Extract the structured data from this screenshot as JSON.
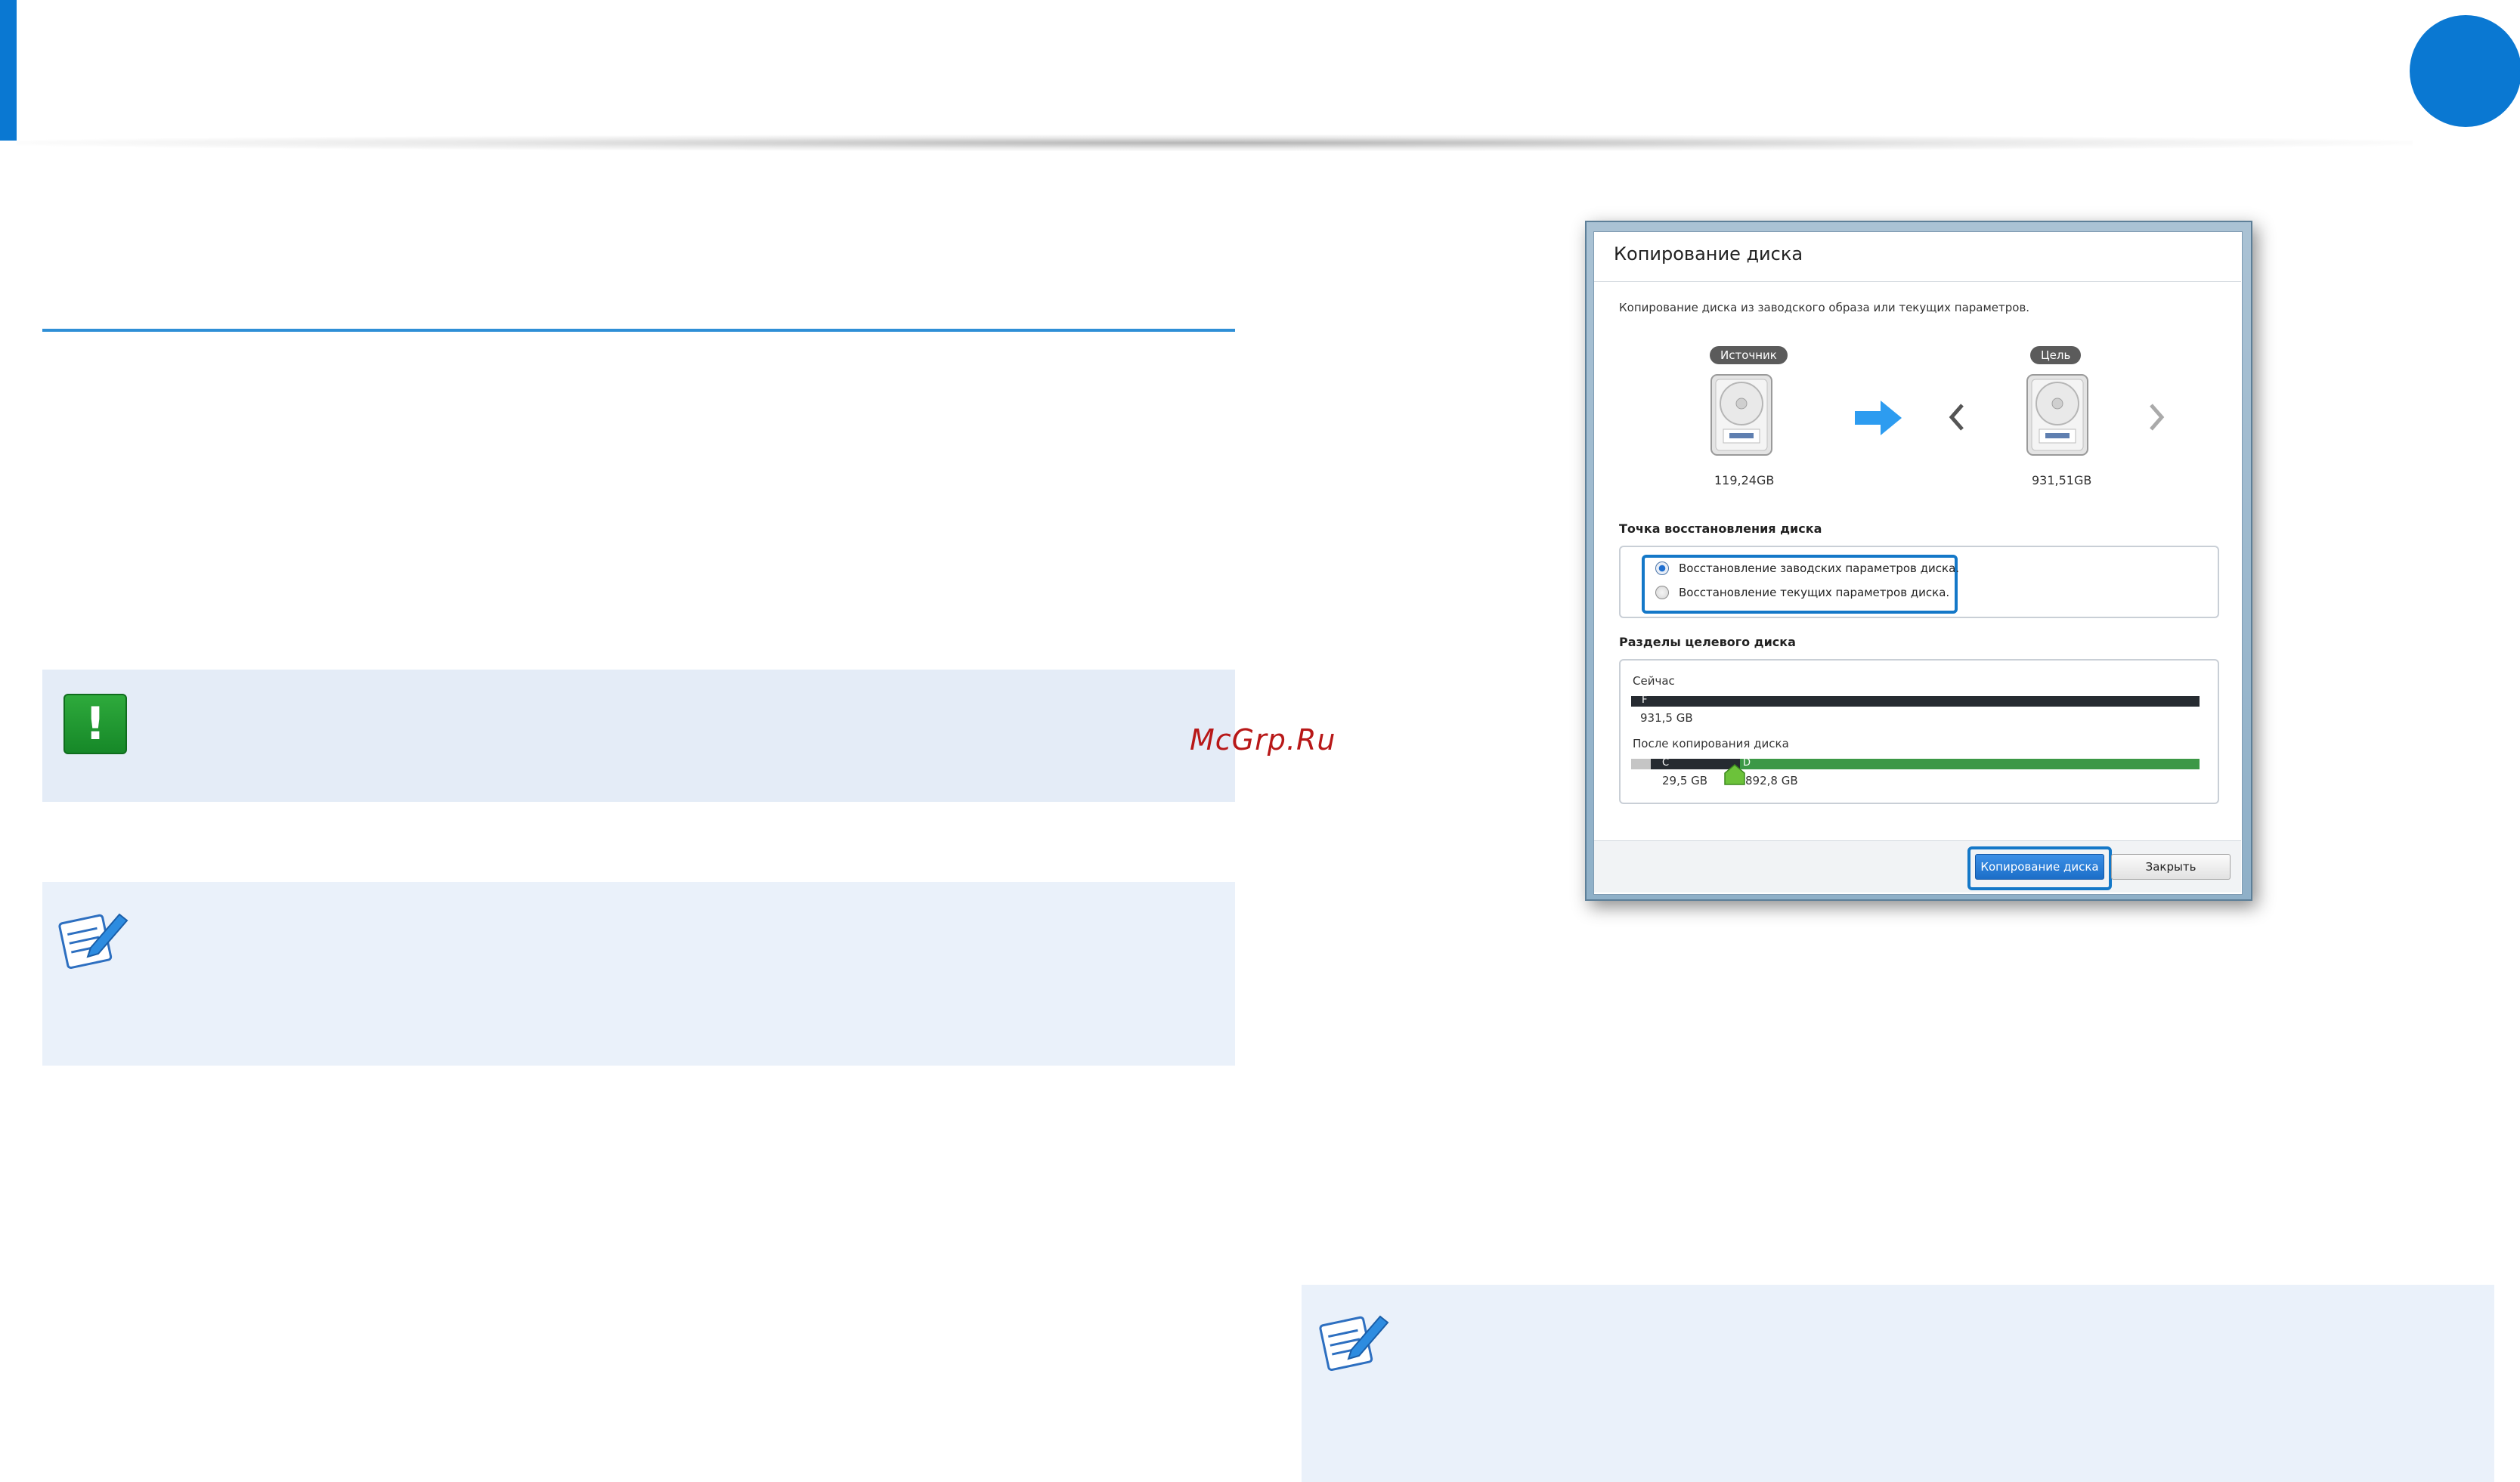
{
  "dialog": {
    "title": "Копирование диска",
    "description": "Копирование диска из заводского образа или текущих параметров.",
    "source": {
      "label": "Источник",
      "size": "119,24GB"
    },
    "target": {
      "label": "Цель",
      "size": "931,51GB"
    },
    "restore_point": {
      "label": "Точка восстановления диска",
      "options": [
        {
          "label": "Восстановление заводских параметров диска.",
          "selected": true
        },
        {
          "label": "Восстановление текущих параметров диска.",
          "selected": false
        }
      ]
    },
    "partitions": {
      "label": "Разделы целевого диска",
      "now": {
        "label": "Сейчас",
        "letter": "F",
        "size": "931,5 GB"
      },
      "after": {
        "label": "После копирования диска",
        "c": {
          "letter": "C",
          "size": "29,5 GB"
        },
        "d": {
          "letter": "D",
          "size": "892,8 GB"
        }
      }
    },
    "buttons": {
      "copy": "Копирование диска",
      "close": "Закрыть"
    }
  },
  "icons": {
    "caution": "exclamation-icon",
    "note": "memo-pencil-icon",
    "disk": "hard-disk-icon",
    "arrow": "right-arrow-icon"
  },
  "watermark": "McGrp.Ru",
  "colors": {
    "accent": "#0a78d2",
    "highlight": "#1478c8",
    "caution": "#1f9a2f"
  }
}
